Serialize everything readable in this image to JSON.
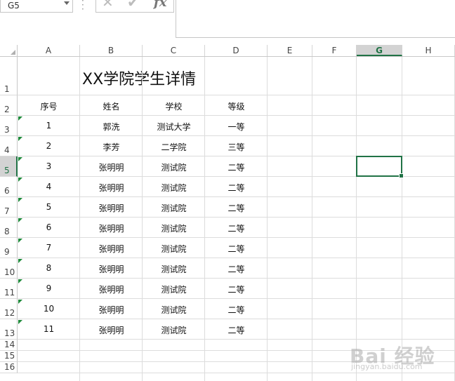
{
  "name_box": {
    "value": "G5"
  },
  "formula_bar": {
    "cancel_icon": "✕",
    "enter_icon": "✔",
    "fx_label": "fx",
    "value": ""
  },
  "columns": [
    "A",
    "B",
    "C",
    "D",
    "E",
    "F",
    "G",
    "H"
  ],
  "selected_column": "G",
  "rows": [
    "1",
    "2",
    "3",
    "4",
    "5",
    "6",
    "7",
    "8",
    "9",
    "10",
    "11",
    "12",
    "13",
    "14",
    "15",
    "16"
  ],
  "selected_row": "5",
  "sheet": {
    "title": "XX学院学生详情",
    "headers": [
      "序号",
      "姓名",
      "学校",
      "等级"
    ],
    "data": [
      [
        "1",
        "郭洗",
        "测试大学",
        "一等"
      ],
      [
        "2",
        "李芳",
        "二学院",
        "三等"
      ],
      [
        "3",
        "张明明",
        "测试院",
        "二等"
      ],
      [
        "4",
        "张明明",
        "测试院",
        "二等"
      ],
      [
        "5",
        "张明明",
        "测试院",
        "二等"
      ],
      [
        "6",
        "张明明",
        "测试院",
        "二等"
      ],
      [
        "7",
        "张明明",
        "测试院",
        "二等"
      ],
      [
        "8",
        "张明明",
        "测试院",
        "二等"
      ],
      [
        "9",
        "张明明",
        "测试院",
        "二等"
      ],
      [
        "10",
        "张明明",
        "测试院",
        "二等"
      ],
      [
        "11",
        "张明明",
        "测试院",
        "二等"
      ]
    ]
  },
  "watermark": {
    "text": "Bai 经验",
    "url_text": "jingyan.baidu.com"
  },
  "colors": {
    "accent": "#217346",
    "error_flag": "#1e8a3a"
  }
}
